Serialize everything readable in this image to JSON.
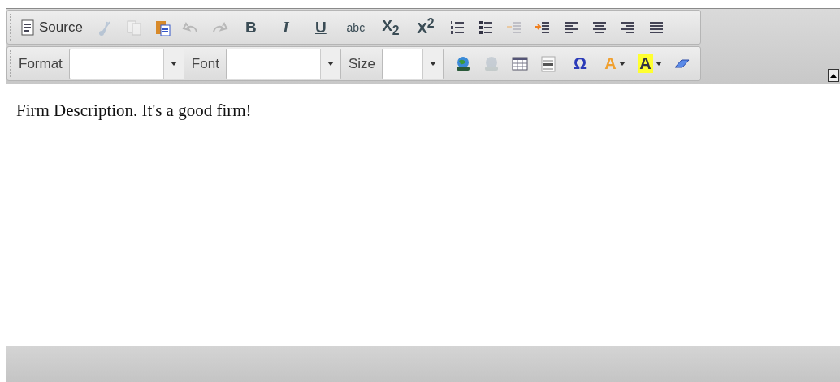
{
  "toolbar_rows": [
    {
      "items": [
        {
          "kind": "source",
          "label": "Source",
          "disabled": false
        },
        {
          "kind": "cut",
          "disabled": true
        },
        {
          "kind": "copy",
          "disabled": true
        },
        {
          "kind": "paste",
          "disabled": false
        },
        {
          "kind": "undo",
          "disabled": true
        },
        {
          "kind": "redo",
          "disabled": true
        },
        {
          "kind": "bold",
          "label": "B",
          "disabled": false
        },
        {
          "kind": "italic",
          "label": "I",
          "disabled": false
        },
        {
          "kind": "underline",
          "label": "U",
          "disabled": false
        },
        {
          "kind": "strike",
          "label": "abc",
          "disabled": false
        },
        {
          "kind": "subscript",
          "label": "X$_{2}$",
          "disabled": false
        },
        {
          "kind": "superscript",
          "label": "X$^{2}$",
          "disabled": false
        },
        {
          "kind": "ordered-list",
          "disabled": false
        },
        {
          "kind": "bullet-list",
          "disabled": false
        },
        {
          "kind": "outdent",
          "disabled": true
        },
        {
          "kind": "indent",
          "disabled": false
        },
        {
          "kind": "align-left",
          "disabled": false
        },
        {
          "kind": "align-center",
          "disabled": false
        },
        {
          "kind": "align-right",
          "disabled": false
        },
        {
          "kind": "justify",
          "disabled": false
        }
      ]
    },
    {
      "items": [
        {
          "kind": "combo",
          "label": "Format",
          "disabled": false
        },
        {
          "kind": "combo",
          "label": "Font",
          "disabled": false
        },
        {
          "kind": "combo",
          "label": "Size",
          "disabled": false
        },
        {
          "kind": "link",
          "disabled": false
        },
        {
          "kind": "unlink",
          "disabled": true
        },
        {
          "kind": "table",
          "disabled": false
        },
        {
          "kind": "rule",
          "disabled": false
        },
        {
          "kind": "special-char",
          "label": "Ω",
          "disabled": false
        },
        {
          "kind": "text-color",
          "label": "A",
          "disabled": false
        },
        {
          "kind": "bg-color",
          "label": "A",
          "disabled": false
        },
        {
          "kind": "eraser",
          "disabled": false
        }
      ]
    }
  ],
  "collapsed": false,
  "content": "Firm Description. It's a good firm!"
}
